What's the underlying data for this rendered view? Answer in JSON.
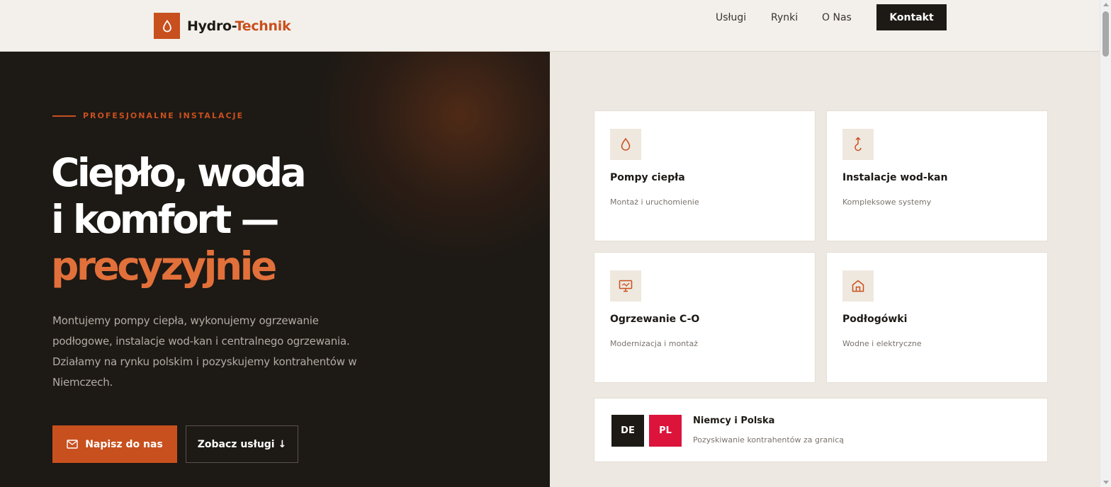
{
  "brand": {
    "name_part1": "Hydro-",
    "name_part2": "Technik",
    "logo_icon": "drop-icon",
    "accent_color": "#c8501e",
    "dark_color": "#1d1915"
  },
  "nav": {
    "links": [
      "Usługi",
      "Rynki",
      "O Nas"
    ],
    "cta_label": "Kontakt"
  },
  "hero": {
    "eyebrow": "PROFESJONALNE INSTALACJE",
    "headline_line1": "Ciepło, woda",
    "headline_line2": "i komfort —",
    "headline_accent": "precyzyjnie",
    "lead": "Montujemy pompy ciepła, wykonujemy ogrzewanie podłogowe, instalacje wod-kan i centralnego ogrzewania. Działamy na rynku polskim i pozyskujemy kontrahentów w Niemczech.",
    "primary_button": "Napisz do nas",
    "primary_button_icon": "mail-icon",
    "secondary_button": "Zobacz usługi ↓"
  },
  "services": [
    {
      "title": "Pompy ciepła",
      "desc": "Montaż i uruchomienie",
      "icon": "drop-icon"
    },
    {
      "title": "Instalacje wod-kan",
      "desc": "Kompleksowe systemy",
      "icon": "pipe-icon"
    },
    {
      "title": "Ogrzewanie C-O",
      "desc": "Modernizacja i montaż",
      "icon": "monitor-icon"
    },
    {
      "title": "Podłogówki",
      "desc": "Wodne i elektryczne",
      "icon": "home-icon"
    }
  ],
  "markets": {
    "flag_de": "DE",
    "flag_pl": "PL",
    "title": "Niemcy i Polska",
    "desc": "Pozyskiwanie kontrahentów za granicą"
  }
}
